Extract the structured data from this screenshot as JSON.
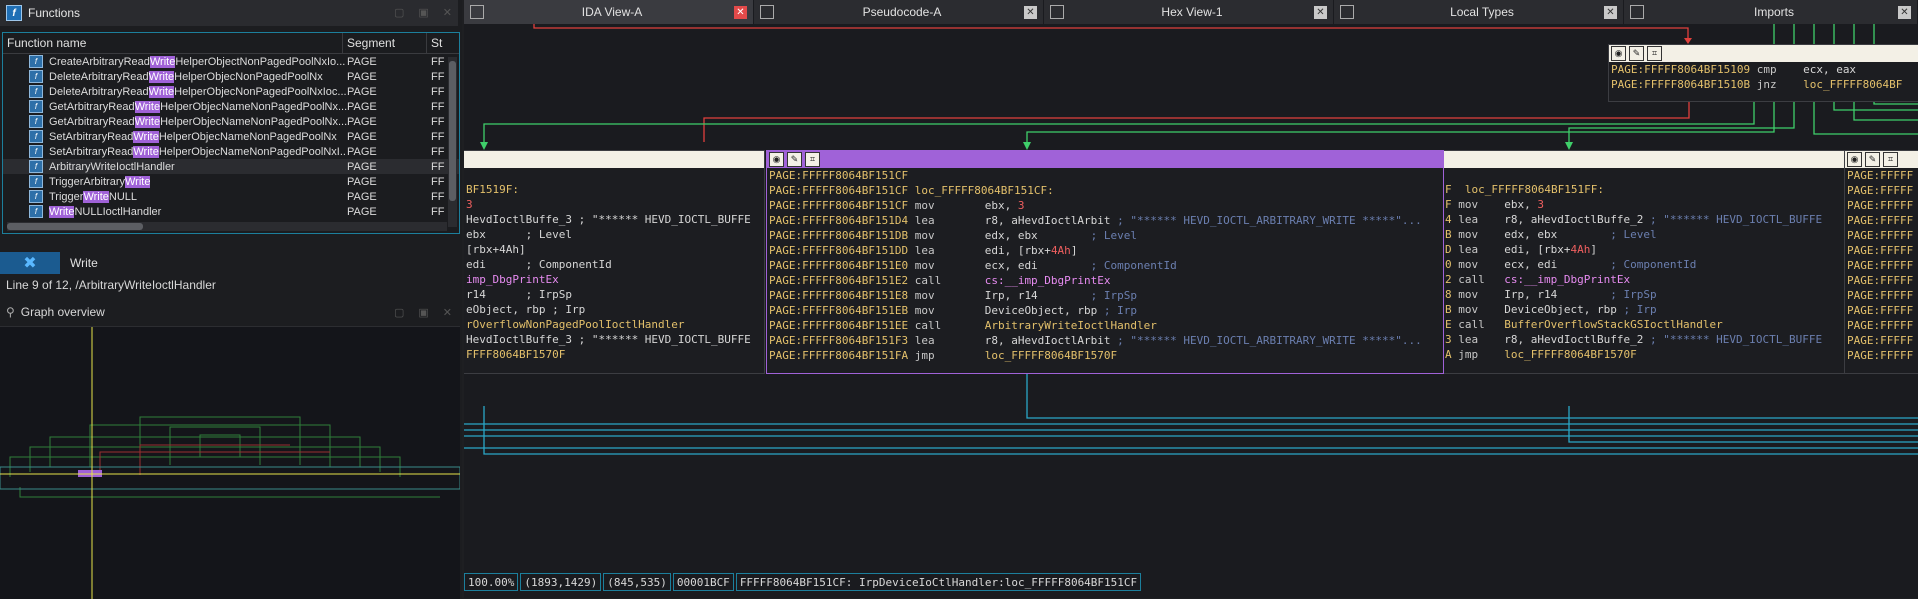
{
  "functions_panel": {
    "title": "Functions",
    "columns": [
      "Function name",
      "Segment",
      "St"
    ],
    "rows": [
      {
        "pre": "CreateArbitraryRead",
        "hl": "Write",
        "post": "HelperObjectNonPagedPoolNxIo...",
        "segment": "PAGE",
        "st": "FF"
      },
      {
        "pre": "DeleteArbitraryRead",
        "hl": "Write",
        "post": "HelperObjecNonPagedPoolNx",
        "segment": "PAGE",
        "st": "FF"
      },
      {
        "pre": "DeleteArbitraryRead",
        "hl": "Write",
        "post": "HelperObjecNonPagedPoolNxIoc...",
        "segment": "PAGE",
        "st": "FF"
      },
      {
        "pre": "GetArbitraryRead",
        "hl": "Write",
        "post": "HelperObjecNameNonPagedPoolNx...",
        "segment": "PAGE",
        "st": "FF"
      },
      {
        "pre": "GetArbitraryRead",
        "hl": "Write",
        "post": "HelperObjecNameNonPagedPoolNx...",
        "segment": "PAGE",
        "st": "FF"
      },
      {
        "pre": "SetArbitraryRead",
        "hl": "Write",
        "post": "HelperObjecNameNonPagedPoolNx",
        "segment": "PAGE",
        "st": "FF"
      },
      {
        "pre": "SetArbitraryRead",
        "hl": "Write",
        "post": "HelperObjecNameNonPagedPoolNxI...",
        "segment": "PAGE",
        "st": "FF"
      },
      {
        "pre": "ArbitraryWriteIoctlHandler",
        "hl": "",
        "post": "",
        "segment": "PAGE",
        "st": "FF"
      },
      {
        "pre": "TriggerArbitrary",
        "hl": "Write",
        "post": "",
        "segment": "PAGE",
        "st": "FF"
      },
      {
        "pre": "Trigger",
        "hl": "Write",
        "post": "NULL",
        "segment": "PAGE",
        "st": "FF"
      },
      {
        "pre": "",
        "hl": "Write",
        "post": "NULLIoctlHandler",
        "segment": "PAGE",
        "st": "FF"
      }
    ],
    "search_value": "Write",
    "line_info": "Line 9 of 12, /ArbitraryWriteIoctlHandler",
    "graph_overview_title": "Graph overview"
  },
  "tabs": [
    {
      "label": "IDA View-A",
      "icon": "disassembly-icon",
      "active": true
    },
    {
      "label": "Pseudocode-A",
      "icon": "pseudocode-icon",
      "active": false
    },
    {
      "label": "Hex View-1",
      "icon": "hex-icon",
      "active": false
    },
    {
      "label": "Local Types",
      "icon": "types-icon",
      "active": false
    },
    {
      "label": "Imports",
      "icon": "imports-icon",
      "active": false
    }
  ],
  "top_block": [
    {
      "addr": "PAGE:FFFFF8064BF15109",
      "mn": "cmp",
      "op": "ecx, eax"
    },
    {
      "addr": "PAGE:FFFFF8064BF1510B",
      "mn": "jnz",
      "op": "loc_FFFFF8064BF"
    }
  ],
  "left_block": {
    "label": "BF1519F:",
    "lines": [
      "3",
      "HevdIoctlBuffe_3 ; \"****** HEVD_IOCTL_BUFFE",
      "ebx      ; Level",
      "[rbx+4Ah]",
      "edi      ; ComponentId",
      "imp_DbgPrintEx",
      "r14      ; IrpSp",
      "eObject, rbp ; Irp",
      "rOverflowNonPagedPoolIoctlHandler",
      "HevdIoctlBuffe_3 ; \"****** HEVD_IOCTL_BUFFE",
      "FFFF8064BF1570F"
    ]
  },
  "center_block": {
    "lines": [
      {
        "addr": "PAGE:FFFFF8064BF151CF",
        "mn": "",
        "op": ""
      },
      {
        "addr": "PAGE:FFFFF8064BF151CF",
        "mn": "loc_FFFFF8064BF151CF:",
        "op": ""
      },
      {
        "addr": "PAGE:FFFFF8064BF151CF",
        "mn": "mov",
        "op": "ebx, 3"
      },
      {
        "addr": "PAGE:FFFFF8064BF151D4",
        "mn": "lea",
        "op": "r8, aHevdIoctlArbit ; \"****** HEVD_IOCTL_ARBITRARY_WRITE *****\"..."
      },
      {
        "addr": "PAGE:FFFFF8064BF151DB",
        "mn": "mov",
        "op": "edx, ebx        ; Level"
      },
      {
        "addr": "PAGE:FFFFF8064BF151DD",
        "mn": "lea",
        "op": "edi, [rbx+4Ah]"
      },
      {
        "addr": "PAGE:FFFFF8064BF151E0",
        "mn": "mov",
        "op": "ecx, edi        ; ComponentId"
      },
      {
        "addr": "PAGE:FFFFF8064BF151E2",
        "mn": "call",
        "op": "cs:__imp_DbgPrintEx"
      },
      {
        "addr": "PAGE:FFFFF8064BF151E8",
        "mn": "mov",
        "op": "Irp, r14        ; IrpSp"
      },
      {
        "addr": "PAGE:FFFFF8064BF151EB",
        "mn": "mov",
        "op": "DeviceObject, rbp ; Irp"
      },
      {
        "addr": "PAGE:FFFFF8064BF151EE",
        "mn": "call",
        "op": "ArbitraryWriteIoctlHandler"
      },
      {
        "addr": "PAGE:FFFFF8064BF151F3",
        "mn": "lea",
        "op": "r8, aHevdIoctlArbit ; \"****** HEVD_IOCTL_ARBITRARY_WRITE *****\"..."
      },
      {
        "addr": "PAGE:FFFFF8064BF151FA",
        "mn": "jmp",
        "op": "loc_FFFFF8064BF1570F"
      }
    ]
  },
  "right_block": {
    "label": "F  loc_FFFFF8064BF151FF:",
    "lines": [
      {
        "c": "F",
        "mn": "mov",
        "op": "ebx, 3"
      },
      {
        "c": "4",
        "mn": "lea",
        "op": "r8, aHevdIoctlBuffe_2 ; \"****** HEVD_IOCTL_BUFFE"
      },
      {
        "c": "B",
        "mn": "mov",
        "op": "edx, ebx        ; Level"
      },
      {
        "c": "D",
        "mn": "lea",
        "op": "edi, [rbx+4Ah]"
      },
      {
        "c": "0",
        "mn": "mov",
        "op": "ecx, edi        ; ComponentId"
      },
      {
        "c": "2",
        "mn": "call",
        "op": "cs:__imp_DbgPrintEx"
      },
      {
        "c": "8",
        "mn": "mov",
        "op": "Irp, r14        ; IrpSp"
      },
      {
        "c": "B",
        "mn": "mov",
        "op": "DeviceObject, rbp ; Irp"
      },
      {
        "c": "E",
        "mn": "call",
        "op": "BufferOverflowStackGSIoctlHandler"
      },
      {
        "c": "3",
        "mn": "lea",
        "op": "r8, aHevdIoctlBuffe_2 ; \"****** HEVD_IOCTL_BUFFE"
      },
      {
        "c": "A",
        "mn": "jmp",
        "op": "loc_FFFFF8064BF1570F"
      }
    ]
  },
  "far_right_block": {
    "lines": [
      "PAGE:FFFFF",
      "PAGE:FFFFF",
      "PAGE:FFFFF",
      "PAGE:FFFFF",
      "PAGE:FFFFF",
      "PAGE:FFFFF",
      "PAGE:FFFFF",
      "PAGE:FFFFF",
      "PAGE:FFFFF",
      "PAGE:FFFFF",
      "PAGE:FFFFF",
      "PAGE:FFFFF",
      "PAGE:FFFFF"
    ]
  },
  "status": {
    "zoom": "100.00%",
    "coords1": "(1893,1429)",
    "coords2": "(845,535)",
    "offset": "00001BCF",
    "location": "FFFFF8064BF151CF: IrpDeviceIoCtlHandler:loc_FFFFF8064BF151CF"
  },
  "colors": {
    "accent": "#1c7f9c",
    "highlight": "#a062d8",
    "edge_green": "#3fcf6a",
    "edge_red": "#e0403c",
    "edge_blue": "#2aa7c7"
  }
}
